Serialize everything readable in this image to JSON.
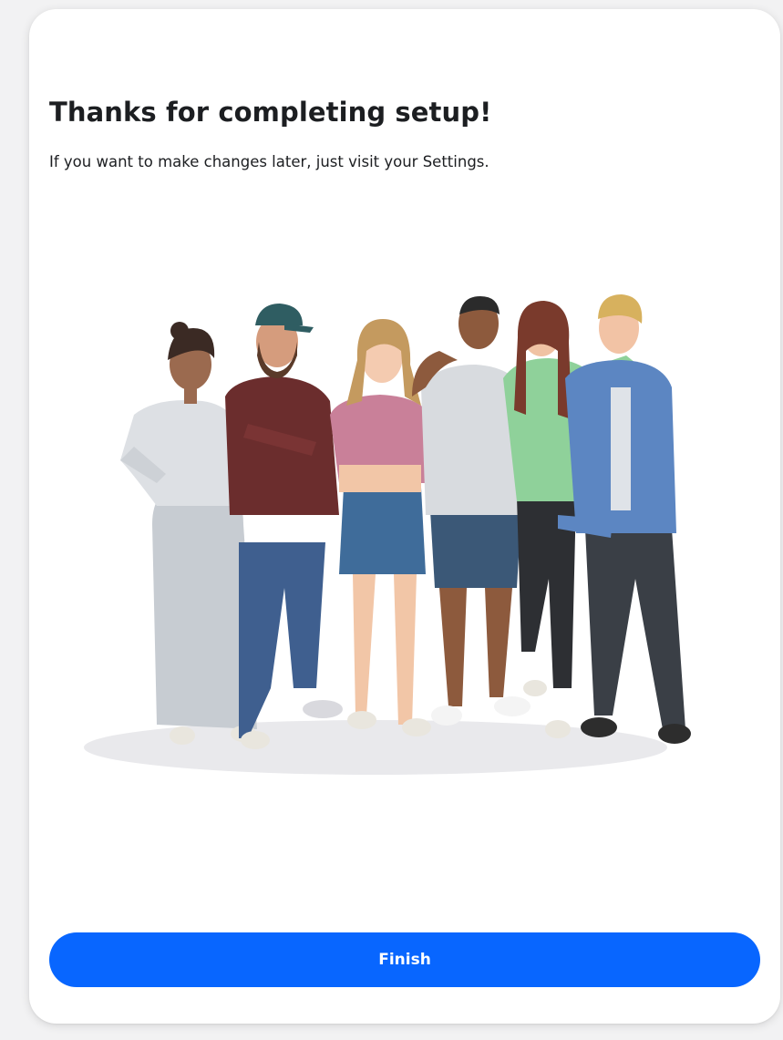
{
  "dialog": {
    "title": "Thanks for completing setup!",
    "subtitle": "If you want to make changes later, just visit your Settings.",
    "illustration": "group-of-six-avatars-illustration",
    "finish_label": "Finish",
    "accent_color": "#0866ff"
  }
}
